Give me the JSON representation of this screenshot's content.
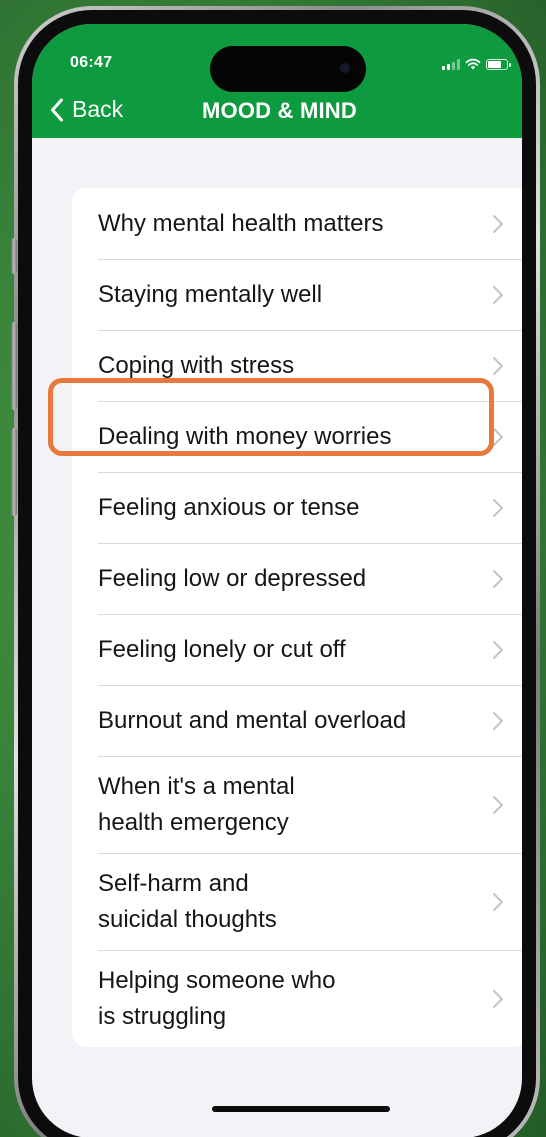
{
  "status_bar": {
    "time": "06:47"
  },
  "nav": {
    "back_label": "Back",
    "title": "MOOD & MIND",
    "header_color": "#0e9a3e"
  },
  "menu": {
    "items": [
      {
        "label": "Why mental health matters"
      },
      {
        "label": "Staying mentally well"
      },
      {
        "label": "Coping with stress"
      },
      {
        "label": "Dealing with money worries",
        "highlighted": true
      },
      {
        "label": "Feeling anxious or tense"
      },
      {
        "label": "Feeling low or depressed"
      },
      {
        "label": "Feeling lonely or cut off"
      },
      {
        "label": "Burnout and mental overload"
      },
      {
        "label": "When it's a mental\nhealth emergency"
      },
      {
        "label": "Self-harm and\nsuicidal thoughts"
      },
      {
        "label": "Helping someone who\nis struggling"
      }
    ],
    "chevron_icon": "chevron-right-icon",
    "highlight_color": "#e77a3c"
  }
}
